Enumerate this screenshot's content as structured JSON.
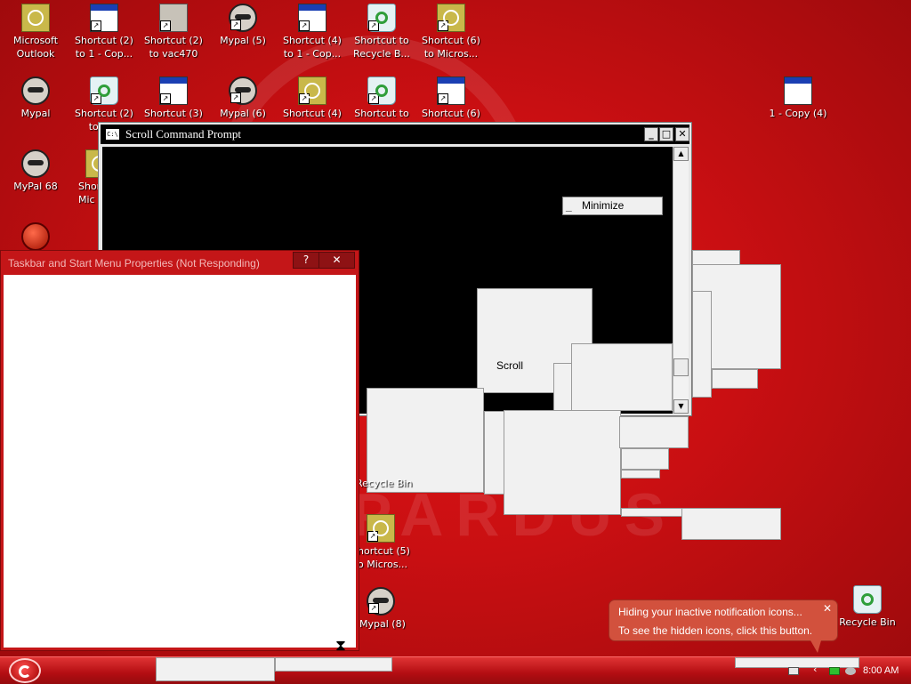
{
  "desktop_icons": [
    {
      "label": "Microsoft Outlook",
      "icon": "outlook-icon"
    },
    {
      "label": "Shortcut (2) to 1 - Cop...",
      "icon": "window-shortcut-icon"
    },
    {
      "label": "Shortcut (2) to vac470",
      "icon": "network-shortcut-icon"
    },
    {
      "label": "Mypal (5)",
      "icon": "mypal-icon"
    },
    {
      "label": "Shortcut (4) to 1 - Cop...",
      "icon": "window-shortcut-icon"
    },
    {
      "label": "Shortcut to Recycle B...",
      "icon": "recycle-shortcut-icon"
    },
    {
      "label": "Shortcut (6) to Micros...",
      "icon": "outlook-shortcut-icon"
    },
    {
      "label": "Mypal",
      "icon": "mypal-icon"
    },
    {
      "label": "Shortcut (2) to Rec",
      "icon": "recycle-shortcut-icon"
    },
    {
      "label": "Shortcut (3)",
      "icon": "window-shortcut-icon"
    },
    {
      "label": "Mypal (6)",
      "icon": "mypal-icon"
    },
    {
      "label": "Shortcut (4)",
      "icon": "outlook-shortcut-icon"
    },
    {
      "label": "Shortcut to",
      "icon": "recycle-shortcut-icon"
    },
    {
      "label": "Shortcut (6)",
      "icon": "window-shortcut-icon"
    },
    {
      "label": "1 - Copy (4)",
      "icon": "window-icon"
    },
    {
      "label": "MyPal 68",
      "icon": "mypal-icon"
    },
    {
      "label": "Shor Mic",
      "icon": "outlook-shortcut-icon"
    },
    {
      "label": "",
      "icon": "red-ball-icon"
    },
    {
      "label": "Recycle Bin",
      "icon": "recycle-shortcut-icon"
    },
    {
      "label": "hortcut (5) o Micros...",
      "icon": "outlook-shortcut-icon"
    },
    {
      "label": "Mypal (8)",
      "icon": "mypal-icon"
    },
    {
      "label": "Recycle Bin",
      "icon": "recycle-bin-icon"
    }
  ],
  "cmd_window": {
    "title": "Scroll Command Prompt",
    "icon_text": "C:\\",
    "minimize_glyph": "_",
    "maximize_glyph": "□",
    "close_glyph": "✕",
    "scroll_up_glyph": "▲",
    "scroll_down_glyph": "▼"
  },
  "context_menu": {
    "item_icon": "_",
    "item_label": "Minimize"
  },
  "ghost_label": "Scroll",
  "props_window": {
    "title": "Taskbar and Start Menu Properties (Not Responding)",
    "help_glyph": "?",
    "close_glyph": "✕",
    "cursor_glyph": "⧗"
  },
  "balloon": {
    "title": "Hiding your inactive notification icons...",
    "body": "To see the hidden icons, click this button.",
    "close_glyph": "✕"
  },
  "taskbar": {
    "clock": "8:00 AM"
  },
  "colors": {
    "desktop": "#c90f12",
    "taskbar": "#b30d12",
    "console": "#000000",
    "balloon": "#d2513d"
  }
}
